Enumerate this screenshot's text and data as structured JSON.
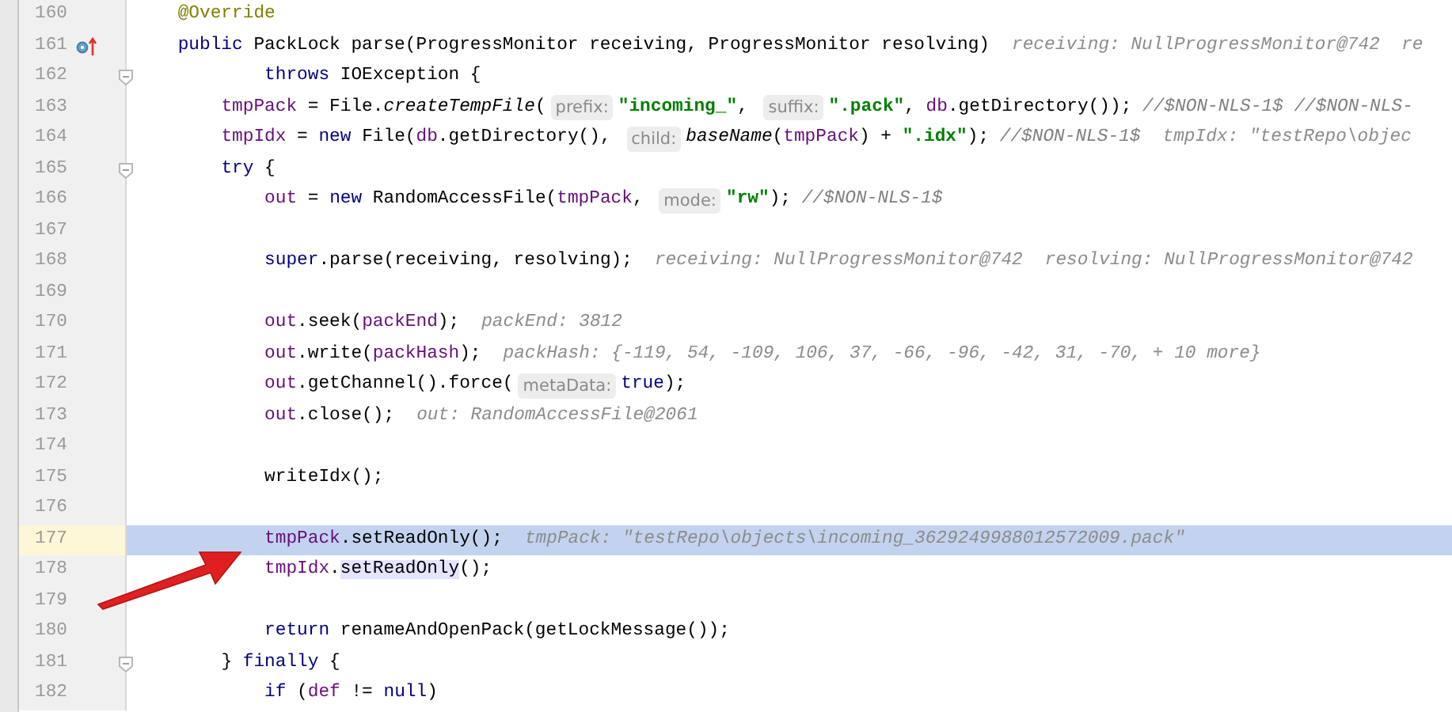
{
  "editor": {
    "lines": [
      {
        "number": "160",
        "selected": false,
        "fold": false,
        "marker": false,
        "tokens": [
          {
            "kind": "ann",
            "text": "    @Override"
          }
        ]
      },
      {
        "number": "161",
        "selected": false,
        "fold": false,
        "marker": true,
        "tokens": [
          {
            "kind": "kw",
            "text": "    public"
          },
          {
            "kind": "plain",
            "text": " PackLock parse(ProgressMonitor receiving, ProgressMonitor resolving)"
          },
          {
            "kind": "hint",
            "text": "receiving: NullProgressMonitor@742  re"
          }
        ]
      },
      {
        "number": "162",
        "selected": false,
        "fold": true,
        "marker": false,
        "tokens": [
          {
            "kind": "kw",
            "text": "            throws"
          },
          {
            "kind": "plain",
            "text": " IOException {"
          }
        ]
      },
      {
        "number": "163",
        "selected": false,
        "fold": false,
        "marker": false,
        "tokens": [
          {
            "kind": "field",
            "text": "        tmpPack"
          },
          {
            "kind": "plain",
            "text": " = File."
          },
          {
            "kind": "static",
            "text": "createTempFile"
          },
          {
            "kind": "plain",
            "text": "("
          },
          {
            "kind": "chip",
            "text": "prefix:"
          },
          {
            "kind": "str",
            "text": "\"incoming_\""
          },
          {
            "kind": "plain",
            "text": ", "
          },
          {
            "kind": "chip",
            "text": "suffix:"
          },
          {
            "kind": "str",
            "text": "\".pack\""
          },
          {
            "kind": "plain",
            "text": ", "
          },
          {
            "kind": "field",
            "text": "db"
          },
          {
            "kind": "plain",
            "text": ".getDirectory()); "
          },
          {
            "kind": "comment",
            "text": "//$NON-NLS-1$ //$NON-NLS-"
          }
        ]
      },
      {
        "number": "164",
        "selected": false,
        "fold": false,
        "marker": false,
        "tokens": [
          {
            "kind": "field",
            "text": "        tmpIdx"
          },
          {
            "kind": "plain",
            "text": " = "
          },
          {
            "kind": "kw",
            "text": "new"
          },
          {
            "kind": "plain",
            "text": " File("
          },
          {
            "kind": "field",
            "text": "db"
          },
          {
            "kind": "plain",
            "text": ".getDirectory(), "
          },
          {
            "kind": "chip",
            "text": "child:"
          },
          {
            "kind": "static",
            "text": "baseName"
          },
          {
            "kind": "plain",
            "text": "("
          },
          {
            "kind": "field",
            "text": "tmpPack"
          },
          {
            "kind": "plain",
            "text": ") + "
          },
          {
            "kind": "str",
            "text": "\".idx\""
          },
          {
            "kind": "plain",
            "text": "); "
          },
          {
            "kind": "comment",
            "text": "//$NON-NLS-1$"
          },
          {
            "kind": "hint",
            "text": "tmpIdx: \"testRepo\\objec"
          }
        ]
      },
      {
        "number": "165",
        "selected": false,
        "fold": true,
        "marker": false,
        "tokens": [
          {
            "kind": "kw",
            "text": "        try"
          },
          {
            "kind": "plain",
            "text": " {"
          }
        ]
      },
      {
        "number": "166",
        "selected": false,
        "fold": false,
        "marker": false,
        "tokens": [
          {
            "kind": "field",
            "text": "            out"
          },
          {
            "kind": "plain",
            "text": " = "
          },
          {
            "kind": "kw",
            "text": "new"
          },
          {
            "kind": "plain",
            "text": " RandomAccessFile("
          },
          {
            "kind": "field",
            "text": "tmpPack"
          },
          {
            "kind": "plain",
            "text": ", "
          },
          {
            "kind": "chip",
            "text": "mode:"
          },
          {
            "kind": "str",
            "text": "\"rw\""
          },
          {
            "kind": "plain",
            "text": "); "
          },
          {
            "kind": "comment",
            "text": "//$NON-NLS-1$"
          }
        ]
      },
      {
        "number": "167",
        "selected": false,
        "fold": false,
        "marker": false
      },
      {
        "number": "168",
        "selected": false,
        "fold": false,
        "marker": false,
        "tokens": [
          {
            "kind": "kw",
            "text": "            super"
          },
          {
            "kind": "plain",
            "text": ".parse(receiving, resolving);"
          },
          {
            "kind": "hint",
            "text": "receiving: NullProgressMonitor@742"
          },
          {
            "kind": "hint",
            "text": "resolving: NullProgressMonitor@742"
          }
        ]
      },
      {
        "number": "169",
        "selected": false,
        "fold": false,
        "marker": false
      },
      {
        "number": "170",
        "selected": false,
        "fold": false,
        "marker": false,
        "tokens": [
          {
            "kind": "field",
            "text": "            out"
          },
          {
            "kind": "plain",
            "text": ".seek("
          },
          {
            "kind": "field",
            "text": "packEnd"
          },
          {
            "kind": "plain",
            "text": ");"
          },
          {
            "kind": "hint",
            "text": "packEnd: 3812"
          }
        ]
      },
      {
        "number": "171",
        "selected": false,
        "fold": false,
        "marker": false,
        "tokens": [
          {
            "kind": "field",
            "text": "            out"
          },
          {
            "kind": "plain",
            "text": ".write("
          },
          {
            "kind": "field",
            "text": "packHash"
          },
          {
            "kind": "plain",
            "text": ");"
          },
          {
            "kind": "hint",
            "text": "packHash: {-119, 54, -109, 106, 37, -66, -96, -42, 31, -70, + 10 more}"
          }
        ]
      },
      {
        "number": "172",
        "selected": false,
        "fold": false,
        "marker": false,
        "tokens": [
          {
            "kind": "field",
            "text": "            out"
          },
          {
            "kind": "plain",
            "text": ".getChannel().force("
          },
          {
            "kind": "chip",
            "text": "metaData:"
          },
          {
            "kind": "kw",
            "text": "true"
          },
          {
            "kind": "plain",
            "text": ");"
          }
        ]
      },
      {
        "number": "173",
        "selected": false,
        "fold": false,
        "marker": false,
        "tokens": [
          {
            "kind": "field",
            "text": "            out"
          },
          {
            "kind": "plain",
            "text": ".close();"
          },
          {
            "kind": "hint",
            "text": "out: RandomAccessFile@2061"
          }
        ]
      },
      {
        "number": "174",
        "selected": false,
        "fold": false,
        "marker": false
      },
      {
        "number": "175",
        "selected": false,
        "fold": false,
        "marker": false,
        "tokens": [
          {
            "kind": "plain",
            "text": "            writeIdx();"
          }
        ]
      },
      {
        "number": "176",
        "selected": false,
        "fold": false,
        "marker": false
      },
      {
        "number": "177",
        "selected": true,
        "fold": false,
        "marker": false,
        "tokens": [
          {
            "kind": "field",
            "text": "            tmpPack"
          },
          {
            "kind": "plain",
            "text": ".setReadOnly();"
          },
          {
            "kind": "hint",
            "text": "tmpPack: \"testRepo\\objects\\incoming_3629249988012572009.pack\""
          }
        ]
      },
      {
        "number": "178",
        "selected": false,
        "fold": false,
        "marker": false,
        "tokens": [
          {
            "kind": "field",
            "text": "            tmpIdx"
          },
          {
            "kind": "plain",
            "text": "."
          },
          {
            "kind": "usage",
            "text": "setReadOnly"
          },
          {
            "kind": "plain",
            "text": "();"
          }
        ]
      },
      {
        "number": "179",
        "selected": false,
        "fold": false,
        "marker": false
      },
      {
        "number": "180",
        "selected": false,
        "fold": false,
        "marker": false,
        "tokens": [
          {
            "kind": "kw",
            "text": "            return"
          },
          {
            "kind": "plain",
            "text": " renameAndOpenPack(getLockMessage());"
          }
        ]
      },
      {
        "number": "181",
        "selected": false,
        "fold": true,
        "marker": false,
        "tokens": [
          {
            "kind": "plain",
            "text": "        } "
          },
          {
            "kind": "kw",
            "text": "finally"
          },
          {
            "kind": "plain",
            "text": " {"
          }
        ]
      },
      {
        "number": "182",
        "selected": false,
        "fold": false,
        "marker": false,
        "tokens": [
          {
            "kind": "kw",
            "text": "            if"
          },
          {
            "kind": "plain",
            "text": " ("
          },
          {
            "kind": "field",
            "text": "def"
          },
          {
            "kind": "plain",
            "text": " != "
          },
          {
            "kind": "kw",
            "text": "null"
          },
          {
            "kind": "plain",
            "text": ")"
          }
        ]
      }
    ]
  }
}
